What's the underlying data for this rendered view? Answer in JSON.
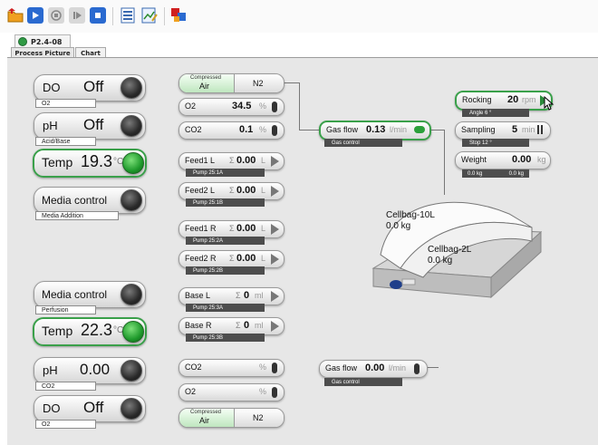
{
  "toolbar": {
    "icons": [
      "open-folder-icon",
      "play-icon",
      "stop-circle-icon",
      "step-play-icon",
      "stop-icon",
      "list-icon",
      "chart-edit-icon",
      "multi-colour-icon"
    ]
  },
  "project_tab": {
    "label": "P2.4-08",
    "status_color": "#2f9a44"
  },
  "view_tabs": [
    {
      "label": "Process Picture",
      "active": true
    },
    {
      "label": "Chart",
      "active": false
    }
  ],
  "left_controls": {
    "do_top": {
      "name": "DO",
      "value": "Off",
      "sub": "O2"
    },
    "ph_top": {
      "name": "pH",
      "value": "Off",
      "sub": "Acid/Base"
    },
    "temp_top": {
      "name": "Temp",
      "value": "19.3",
      "unit": "°C"
    },
    "media_top": {
      "name": "Media control",
      "sub": "Media Addition"
    },
    "media_bottom": {
      "name": "Media control",
      "sub": "Perfusion"
    },
    "temp_bottom": {
      "name": "Temp",
      "value": "22.3",
      "unit": "°C"
    },
    "ph_bottom": {
      "name": "pH",
      "value": "0.00",
      "sub": "CO2"
    },
    "do_bottom": {
      "name": "DO",
      "value": "Off",
      "sub": "O2"
    }
  },
  "gas_top": {
    "selector": {
      "left_small": "Compressed",
      "left": "Air",
      "right": "N2"
    },
    "o2": {
      "name": "O2",
      "value": "34.5",
      "unit": "%"
    },
    "co2": {
      "name": "CO2",
      "value": "0.1",
      "unit": "%"
    }
  },
  "pumps": [
    {
      "name": "Feed1 L",
      "sigma": "Σ",
      "value": "0.00",
      "unit": "L",
      "sub": "Pump 25:1A"
    },
    {
      "name": "Feed2 L",
      "sigma": "Σ",
      "value": "0.00",
      "unit": "L",
      "sub": "Pump 25:1B"
    },
    {
      "name": "Feed1 R",
      "sigma": "Σ",
      "value": "0.00",
      "unit": "L",
      "sub": "Pump 25:2A"
    },
    {
      "name": "Feed2 R",
      "sigma": "Σ",
      "value": "0.00",
      "unit": "L",
      "sub": "Pump 25:2B"
    },
    {
      "name": "Base L",
      "sigma": "Σ",
      "value": "0",
      "unit": "ml",
      "sub": "Pump 25:3A"
    },
    {
      "name": "Base R",
      "sigma": "Σ",
      "value": "0",
      "unit": "ml",
      "sub": "Pump 25:3B"
    }
  ],
  "gas_bottom": {
    "co2": {
      "name": "CO2",
      "value": "",
      "unit": "%"
    },
    "o2": {
      "name": "O2",
      "value": "",
      "unit": "%"
    },
    "selector": {
      "left_small": "Compressed",
      "left": "Air",
      "right": "N2"
    }
  },
  "gas_flow_top": {
    "name": "Gas flow",
    "value": "0.13",
    "unit": "l/min",
    "sub": "Gas control"
  },
  "gas_flow_bottom": {
    "name": "Gas flow",
    "value": "0.00",
    "unit": "l/min",
    "sub": "Gas control"
  },
  "rocker": {
    "rocking": {
      "name": "Rocking",
      "value": "20",
      "unit": "rpm",
      "sub": "Angle 6 °"
    },
    "sampling": {
      "name": "Sampling",
      "value": "5",
      "unit": "min",
      "sub": "Stop 12 °"
    },
    "weight": {
      "name": "Weight",
      "value": "0.00",
      "unit": "kg",
      "sub_left": "0.0 kg",
      "sub_right": "0.0 kg"
    }
  },
  "cellbags": [
    {
      "name": "Cellbag-10L",
      "weight": "0.0 kg"
    },
    {
      "name": "Cellbag-2L",
      "weight": "0.0 kg"
    }
  ],
  "colors": {
    "accent_green": "#3aa04a",
    "panel": "#e7e7e7"
  }
}
